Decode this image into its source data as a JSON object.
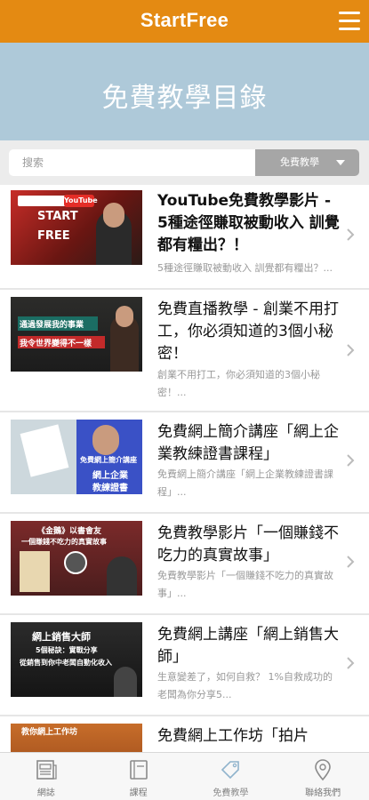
{
  "header": {
    "app_title": "StartFree",
    "menu_icon": "hamburger-menu-icon"
  },
  "hero": {
    "title": "免費教學目錄"
  },
  "search": {
    "placeholder": "搜索",
    "category_selected": "免費教學"
  },
  "list": {
    "items": [
      {
        "title": "YouTube免費教學影片 - 5種途徑賺取被動收入 訓覺都有糧出？！",
        "desc": "5種途徑賺取被動收入 訓覺都有糧出？...",
        "thumb_caption": [
          "START",
          "FREE"
        ],
        "thumb_badge": "YouTube"
      },
      {
        "title": "免費直播教學 - 創業不用打工，你必須知道的3個小秘密！",
        "desc": "創業不用打工，你必須知道的3個小秘密！...",
        "thumb_caption": [
          "通過發展我的事業",
          "我令世界變得不一樣"
        ]
      },
      {
        "title": "免費網上簡介講座「網上企業教練證書課程」",
        "desc": "免費網上簡介講座「網上企業教練證書課程」...",
        "thumb_caption": [
          "免費網上簡介講座",
          "網上企業",
          "教練證書"
        ]
      },
      {
        "title": "免費教學影片「一個賺錢不吃力的真實故事」",
        "desc": "免費教學影片「一個賺錢不吃力的真實故事」...",
        "thumb_caption": [
          "《金鵝》以書會友",
          "一個賺錢不吃力的真實故事"
        ]
      },
      {
        "title": "免費網上講座「網上銷售大師」",
        "desc": "生意變差了，如何自救？ 1%自救成功的老闆為你分享5...",
        "thumb_caption": [
          "網上銷售大師",
          "5個秘訣：實戰分享",
          "從銷售到你中老闆自動化收入"
        ]
      },
      {
        "title": "免費網上工作坊「拍片",
        "desc": "",
        "thumb_caption": [
          "教你網上工作坊"
        ]
      }
    ]
  },
  "tabbar": {
    "items": [
      {
        "label": "網誌",
        "icon": "document-icon"
      },
      {
        "label": "課程",
        "icon": "book-icon"
      },
      {
        "label": "免費教學",
        "icon": "tag-icon"
      },
      {
        "label": "聯絡我們",
        "icon": "location-pin-icon"
      }
    ]
  },
  "colors": {
    "header": "#e48a12",
    "hero": "#aec9d9",
    "select": "#a6a6a6"
  }
}
